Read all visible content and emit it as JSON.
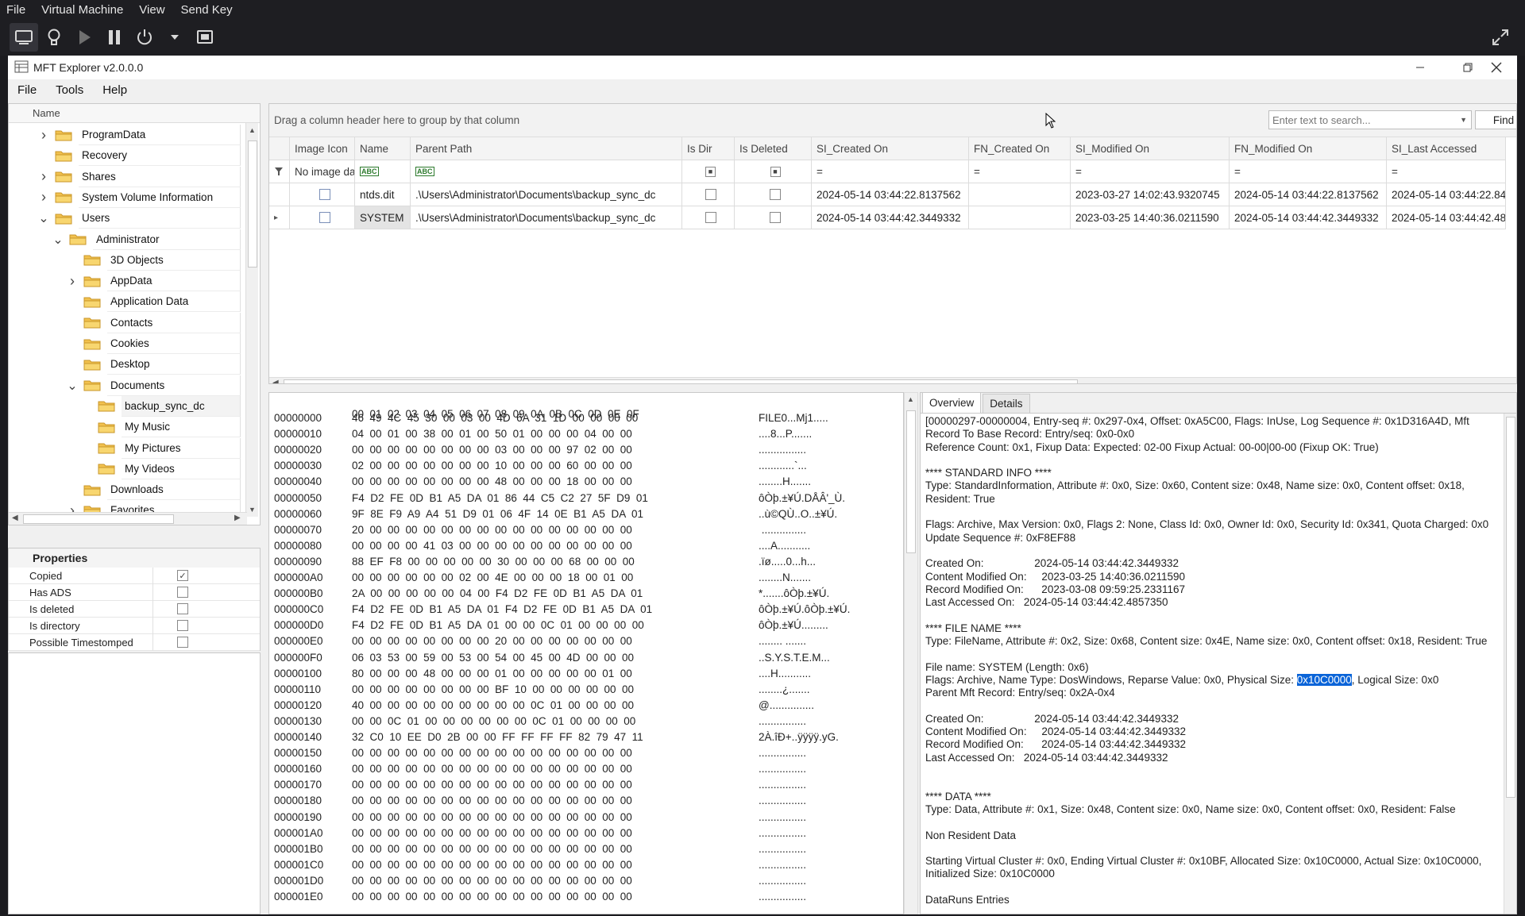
{
  "vm": {
    "menu": [
      "File",
      "Virtual Machine",
      "View",
      "Send Key"
    ]
  },
  "window": {
    "title": "MFT Explorer v2.0.0.0",
    "menu": [
      "File",
      "Tools",
      "Help"
    ]
  },
  "tree": {
    "header": "Name",
    "items": [
      {
        "label": "ProgramData",
        "level": 1,
        "expander": "collapsed"
      },
      {
        "label": "Recovery",
        "level": 1,
        "expander": "none"
      },
      {
        "label": "Shares",
        "level": 1,
        "expander": "collapsed"
      },
      {
        "label": "System Volume Information",
        "level": 1,
        "expander": "collapsed"
      },
      {
        "label": "Users",
        "level": 1,
        "expander": "expanded"
      },
      {
        "label": "Administrator",
        "level": 2,
        "expander": "expanded"
      },
      {
        "label": "3D Objects",
        "level": 3,
        "expander": "none"
      },
      {
        "label": "AppData",
        "level": 3,
        "expander": "collapsed"
      },
      {
        "label": "Application Data",
        "level": 3,
        "expander": "none"
      },
      {
        "label": "Contacts",
        "level": 3,
        "expander": "none"
      },
      {
        "label": "Cookies",
        "level": 3,
        "expander": "none"
      },
      {
        "label": "Desktop",
        "level": 3,
        "expander": "none"
      },
      {
        "label": "Documents",
        "level": 3,
        "expander": "expanded"
      },
      {
        "label": "backup_sync_dc",
        "level": 4,
        "expander": "none",
        "selected": true
      },
      {
        "label": "My Music",
        "level": 4,
        "expander": "none"
      },
      {
        "label": "My Pictures",
        "level": 4,
        "expander": "none"
      },
      {
        "label": "My Videos",
        "level": 4,
        "expander": "none"
      },
      {
        "label": "Downloads",
        "level": 3,
        "expander": "none"
      },
      {
        "label": "Favorites",
        "level": 3,
        "expander": "collapsed"
      }
    ]
  },
  "properties": {
    "title": "Properties",
    "items": [
      {
        "name": "Copied",
        "checked": true
      },
      {
        "name": "Has ADS",
        "checked": false
      },
      {
        "name": "Is deleted",
        "checked": false
      },
      {
        "name": "Is directory",
        "checked": false
      },
      {
        "name": "Possible Timestomped",
        "checked": false
      }
    ]
  },
  "grid": {
    "group_hint": "Drag a column header here to group by that column",
    "search_placeholder": "Enter text to search...",
    "find_label": "Find",
    "columns": [
      "Image Icon",
      "Name",
      "Parent Path",
      "Is Dir",
      "Is Deleted",
      "SI_Created On",
      "FN_Created On",
      "SI_Modified On",
      "FN_Modified On",
      "SI_Last Accessed"
    ],
    "filter_row": {
      "image": "No image data",
      "eq": "="
    },
    "rows": [
      {
        "name": "ntds.dit",
        "parent": ".\\Users\\Administrator\\Documents\\backup_sync_dc",
        "si_created": "2024-05-14 03:44:22.8137562",
        "fn_created": "",
        "si_modified": "2023-03-27 14:02:43.9320745",
        "fn_modified": "2024-05-14 03:44:22.8137562",
        "si_accessed": "2024-05-14 03:44:22.84"
      },
      {
        "name": "SYSTEM",
        "parent": ".\\Users\\Administrator\\Documents\\backup_sync_dc",
        "si_created": "2024-05-14 03:44:42.3449332",
        "fn_created": "",
        "si_modified": "2023-03-25 14:40:36.0211590",
        "fn_modified": "2024-05-14 03:44:42.3449332",
        "si_accessed": "2024-05-14 03:44:42.48"
      }
    ]
  },
  "hex": {
    "header": "00  01  02  03  04  05  06  07  08  09  0A  0B  0C  0D  0E  0F",
    "lines": [
      {
        "off": "00000000",
        "bytes": "46  49  4C  45  30  00  03  00  4D  6A  31  1D  00  00  00  00",
        "ascii": "FILE0...Mj1....."
      },
      {
        "off": "00000010",
        "bytes": "04  00  01  00  38  00  01  00  50  01  00  00  00  04  00  00",
        "ascii": "....8...P......."
      },
      {
        "off": "00000020",
        "bytes": "00  00  00  00  00  00  00  00  03  00  00  00  97  02  00  00",
        "ascii": "................"
      },
      {
        "off": "00000030",
        "bytes": "02  00  00  00  00  00  00  00  10  00  00  00  60  00  00  00",
        "ascii": "............`..."
      },
      {
        "off": "00000040",
        "bytes": "00  00  00  00  00  00  00  00  48  00  00  00  18  00  00  00",
        "ascii": "........H......."
      },
      {
        "off": "00000050",
        "bytes": "F4  D2  FE  0D  B1  A5  DA  01  86  44  C5  C2  27  5F  D9  01",
        "ascii": "ôÒþ.±¥Ú.DÅÂ'_Ù."
      },
      {
        "off": "00000060",
        "bytes": "9F  8E  F9  A9  A4  51  D9  01  06  4F  14  0E  B1  A5  DA  01",
        "ascii": "..ù©QÙ..O..±¥Ú."
      },
      {
        "off": "00000070",
        "bytes": "20  00  00  00  00  00  00  00  00  00  00  00  00  00  00  00",
        "ascii": " ..............."
      },
      {
        "off": "00000080",
        "bytes": "00  00  00  00  41  03  00  00  00  00  00  00  00  00  00  00",
        "ascii": "....A..........."
      },
      {
        "off": "00000090",
        "bytes": "88  EF  F8  00  00  00  00  00  30  00  00  00  68  00  00  00",
        "ascii": ".ïø.....0...h..."
      },
      {
        "off": "000000A0",
        "bytes": "00  00  00  00  00  00  02  00  4E  00  00  00  18  00  01  00",
        "ascii": "........N......."
      },
      {
        "off": "000000B0",
        "bytes": "2A  00  00  00  00  00  04  00  F4  D2  FE  0D  B1  A5  DA  01",
        "ascii": "*.......ôÒþ.±¥Ú."
      },
      {
        "off": "000000C0",
        "bytes": "F4  D2  FE  0D  B1  A5  DA  01  F4  D2  FE  0D  B1  A5  DA  01",
        "ascii": "ôÒþ.±¥Ú.ôÒþ.±¥Ú."
      },
      {
        "off": "000000D0",
        "bytes": "F4  D2  FE  0D  B1  A5  DA  01  00  00  0C  01  00  00  00  00",
        "ascii": "ôÒþ.±¥Ú........."
      },
      {
        "off": "000000E0",
        "bytes": "00  00  00  00  00  00  00  00  20  00  00  00  00  00  00  00",
        "ascii": "........ ......."
      },
      {
        "off": "000000F0",
        "bytes": "06  03  53  00  59  00  53  00  54  00  45  00  4D  00  00  00",
        "ascii": "..S.Y.S.T.E.M..."
      },
      {
        "off": "00000100",
        "bytes": "80  00  00  00  48  00  00  00  01  00  00  00  00  00  01  00",
        "ascii": "....H..........."
      },
      {
        "off": "00000110",
        "bytes": "00  00  00  00  00  00  00  00  BF  10  00  00  00  00  00  00",
        "ascii": "........¿......."
      },
      {
        "off": "00000120",
        "bytes": "40  00  00  00  00  00  00  00  00  00  0C  01  00  00  00  00",
        "ascii": "@..............."
      },
      {
        "off": "00000130",
        "bytes": "00  00  0C  01  00  00  00  00  00  00  0C  01  00  00  00  00",
        "ascii": "................"
      },
      {
        "off": "00000140",
        "bytes": "32  C0  10  EE  D0  2B  00  00  FF  FF  FF  FF  82  79  47  11",
        "ascii": "2À.îÐ+..ÿÿÿÿ.yG."
      },
      {
        "off": "00000150",
        "bytes": "00  00  00  00  00  00  00  00  00  00  00  00  00  00  00  00",
        "ascii": "................"
      },
      {
        "off": "00000160",
        "bytes": "00  00  00  00  00  00  00  00  00  00  00  00  00  00  00  00",
        "ascii": "................"
      },
      {
        "off": "00000170",
        "bytes": "00  00  00  00  00  00  00  00  00  00  00  00  00  00  00  00",
        "ascii": "................"
      },
      {
        "off": "00000180",
        "bytes": "00  00  00  00  00  00  00  00  00  00  00  00  00  00  00  00",
        "ascii": "................"
      },
      {
        "off": "00000190",
        "bytes": "00  00  00  00  00  00  00  00  00  00  00  00  00  00  00  00",
        "ascii": "................"
      },
      {
        "off": "000001A0",
        "bytes": "00  00  00  00  00  00  00  00  00  00  00  00  00  00  00  00",
        "ascii": "................"
      },
      {
        "off": "000001B0",
        "bytes": "00  00  00  00  00  00  00  00  00  00  00  00  00  00  00  00",
        "ascii": "................"
      },
      {
        "off": "000001C0",
        "bytes": "00  00  00  00  00  00  00  00  00  00  00  00  00  00  00  00",
        "ascii": "................"
      },
      {
        "off": "000001D0",
        "bytes": "00  00  00  00  00  00  00  00  00  00  00  00  00  00  00  00",
        "ascii": "................"
      },
      {
        "off": "000001E0",
        "bytes": "00  00  00  00  00  00  00  00  00  00  00  00  00  00  00  00",
        "ascii": "................"
      }
    ]
  },
  "overview": {
    "tabs": [
      "Overview",
      "Details"
    ],
    "text_before": "[00000297-00000004, Entry-seq #: 0x297-0x4, Offset: 0xA5C00, Flags: InUse, Log Sequence #: 0x1D316A4D, Mft\nRecord To Base Record: Entry/seq: 0x0-0x0\nReference Count: 0x1, Fixup Data: Expected: 02-00 Fixup Actual: 00-00|00-00 (Fixup OK: True)\n\n**** STANDARD INFO ****\nType: StandardInformation, Attribute #: 0x0, Size: 0x60, Content size: 0x48, Name size: 0x0, Content offset: 0x18,\nResident: True\n\nFlags: Archive, Max Version: 0x0, Flags 2: None, Class Id: 0x0, Owner Id: 0x0, Security Id: 0x341, Quota Charged: 0x0\nUpdate Sequence #: 0xF8EF88\n\nCreated On:                 2024-05-14 03:44:42.3449332\nContent Modified On:     2023-03-25 14:40:36.0211590\nRecord Modified On:      2023-03-08 09:59:25.2331167\nLast Accessed On:   2024-05-14 03:44:42.4857350\n\n**** FILE NAME ****\nType: FileName, Attribute #: 0x2, Size: 0x68, Content size: 0x4E, Name size: 0x0, Content offset: 0x18, Resident: True\n\nFile name: SYSTEM (Length: 0x6)\nFlags: Archive, Name Type: DosWindows, Reparse Value: 0x0, Physical Size: ",
    "highlight": "0x10C0000",
    "text_after": ", Logical Size: 0x0\nParent Mft Record: Entry/seq: 0x2A-0x4\n\nCreated On:                 2024-05-14 03:44:42.3449332\nContent Modified On:     2024-05-14 03:44:42.3449332\nRecord Modified On:      2024-05-14 03:44:42.3449332\nLast Accessed On:   2024-05-14 03:44:42.3449332\n\n\n**** DATA ****\nType: Data, Attribute #: 0x1, Size: 0x48, Content size: 0x0, Name size: 0x0, Content offset: 0x0, Resident: False\n\nNon Resident Data\n\nStarting Virtual Cluster #: 0x0, Ending Virtual Cluster #: 0x10BF, Allocated Size: 0x10C0000, Actual Size: 0x10C0000,\nInitialized Size: 0x10C0000\n\nDataRuns Entries"
  }
}
